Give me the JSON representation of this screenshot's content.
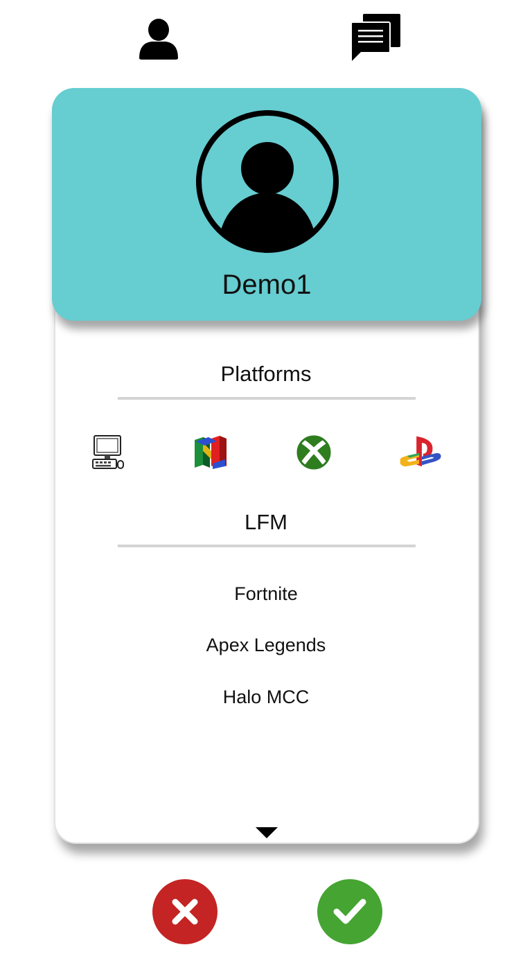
{
  "nav": {
    "profile_icon": "person-icon",
    "messages_icon": "chat-bubbles-icon"
  },
  "profile": {
    "username": "Demo1",
    "avatar_icon": "user-circle-icon",
    "header_color": "#66cdd1"
  },
  "platforms": {
    "title": "Platforms",
    "items": [
      {
        "name": "PC",
        "icon": "pc-desktop-icon"
      },
      {
        "name": "Nintendo 64",
        "icon": "n64-logo-icon"
      },
      {
        "name": "Xbox",
        "icon": "xbox-logo-icon"
      },
      {
        "name": "PlayStation",
        "icon": "playstation-logo-icon"
      }
    ]
  },
  "lfm": {
    "title": "LFM",
    "games": [
      "Fortnite",
      "Apex Legends",
      "Halo MCC"
    ]
  },
  "actions": {
    "reject_icon": "x-icon",
    "reject_color": "#c42424",
    "accept_icon": "check-icon",
    "accept_color": "#46a433"
  }
}
